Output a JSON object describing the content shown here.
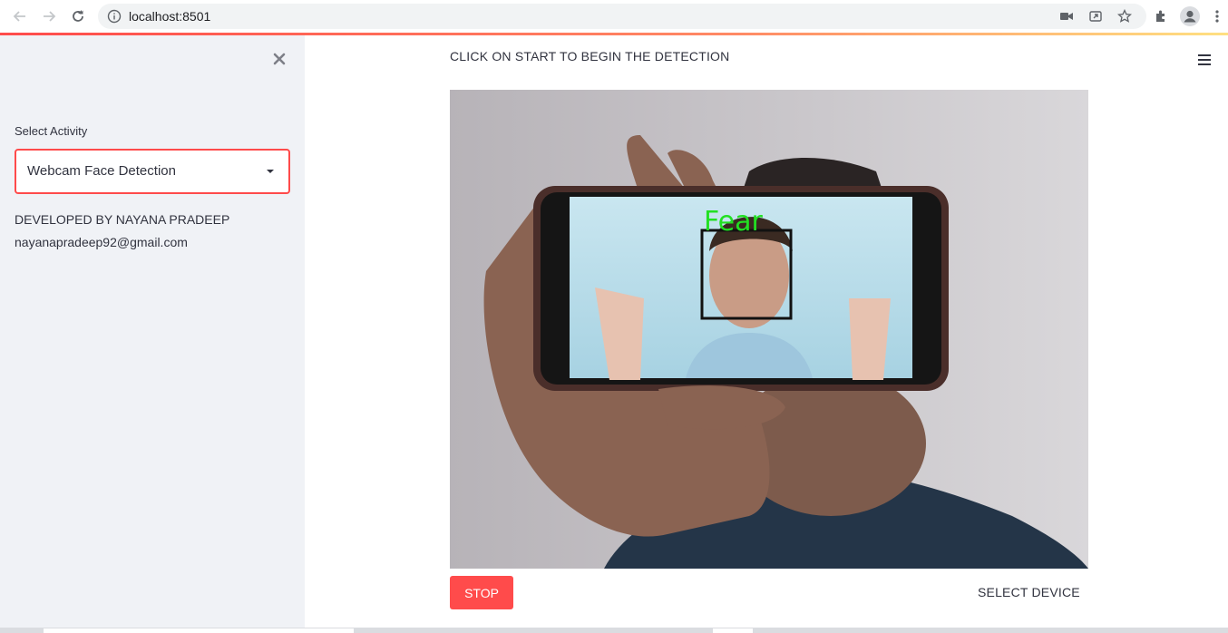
{
  "browser": {
    "url": "localhost:8501"
  },
  "sidebar": {
    "select_label": "Select Activity",
    "select_value": "Webcam Face Detection",
    "developer": "DEVELOPED BY NAYANA PRADEEP",
    "email": "nayanapradeep92@gmail.com"
  },
  "main": {
    "title": "CLICK ON START TO BEGIN THE DETECTION",
    "detected_emotion": "Fear",
    "stop_label": "STOP",
    "select_device_label": "SELECT DEVICE"
  },
  "colors": {
    "accent": "#ff4b4b",
    "sidebar_bg": "#f0f2f6",
    "text": "#31333f",
    "detection_label": "#22e022"
  }
}
